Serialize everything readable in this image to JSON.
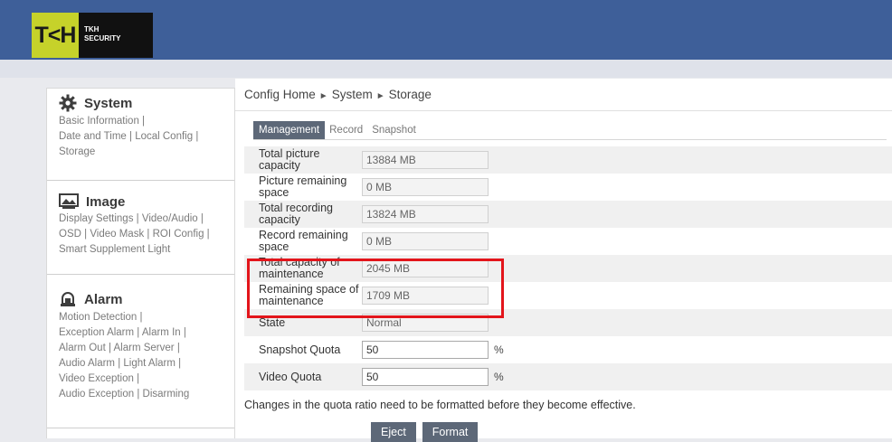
{
  "header": {
    "logo_mark": "T<H",
    "logo_line1": "TKH",
    "logo_line2": "SECURITY"
  },
  "sidebar": {
    "system": {
      "title": "System",
      "links": [
        "Basic Information",
        "Date and Time",
        "Local Config",
        "Storage"
      ]
    },
    "image": {
      "title": "Image",
      "links": [
        "Display Settings",
        "Video/Audio",
        "OSD",
        "Video Mask",
        "ROI Config",
        "Smart Supplement Light"
      ]
    },
    "alarm": {
      "title": "Alarm",
      "links": [
        "Motion Detection",
        "Exception Alarm",
        "Alarm In",
        "Alarm Out",
        "Alarm Server",
        "Audio Alarm",
        "Light Alarm",
        "Video Exception",
        "Audio Exception",
        "Disarming"
      ]
    }
  },
  "breadcrumb": {
    "home": "Config Home",
    "level1": "System",
    "level2": "Storage",
    "separator": "►"
  },
  "tabs": {
    "management": "Management",
    "record": "Record",
    "snapshot": "Snapshot"
  },
  "rows": [
    {
      "label": "Total picture capacity",
      "value": "13884 MB"
    },
    {
      "label": "Picture remaining space",
      "value": "0 MB"
    },
    {
      "label": "Total recording capacity",
      "value": "13824 MB"
    },
    {
      "label": "Record remaining space",
      "value": "0 MB"
    },
    {
      "label": "Total capacity of maintenance",
      "value": "2045 MB"
    },
    {
      "label": "Remaining space of maintenance",
      "value": "1709 MB"
    },
    {
      "label": "State",
      "value": "Normal"
    },
    {
      "label": "Snapshot Quota",
      "value": "50",
      "unit": "%"
    },
    {
      "label": "Video Quota",
      "value": "50",
      "unit": "%"
    }
  ],
  "note": "Changes in the quota ratio need to be formatted before they become effective.",
  "buttons": {
    "eject": "Eject",
    "format": "Format"
  },
  "colors": {
    "header_bg": "#3e5f99",
    "logo_accent": "#c6d22a",
    "active_tab": "#5d6878",
    "highlight": "#e3151b"
  }
}
